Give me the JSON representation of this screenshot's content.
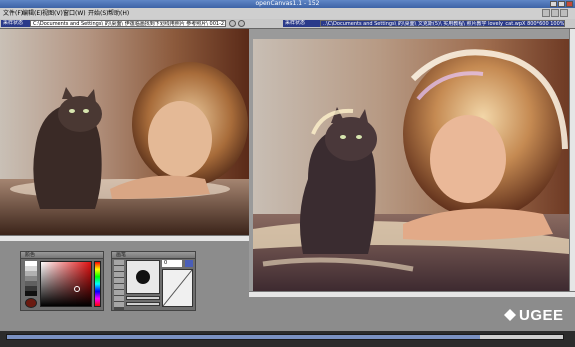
{
  "app": {
    "title": "openCanvas1.1 - 152",
    "window_buttons": [
      "minimize-button",
      "maximize-button",
      "close-button"
    ]
  },
  "menu": {
    "items": [
      "文件(F)",
      "编辑(E)",
      "视图(V)",
      "窗口(W)",
      "开始(S)",
      "帮助(H)"
    ]
  },
  "left_pane": {
    "status_label": "采样状态",
    "path": "C:\\Documents and Settings\\ 的\\桌面\\ 伊莲临画找到下划线用照片 参考照片\\ 001-213.."
  },
  "right_pane": {
    "status_label": "采样状态",
    "path": "..\\C\\Documents and Settings\\ 的\\桌面\\ 文克斯(5)\\ 实用教程\\ 照片教学 lovely_cat.wpX  800*600 100%"
  },
  "color_panel": {
    "title": "颜色",
    "selected_color": "#6b1a10",
    "swatches": [
      "#ffffff",
      "#d8d8d8",
      "#b0b0b0",
      "#888888",
      "#606060",
      "#383838",
      "#101010",
      "#6b1a10"
    ]
  },
  "brush_panel": {
    "title": "画笔",
    "size_readout": "0",
    "tools": [
      "pen-icon",
      "pencil-icon",
      "airbrush-icon",
      "marker-icon",
      "eraser-icon",
      "smudge-icon",
      "blur-icon",
      "watercolor-icon"
    ]
  },
  "brand": {
    "logo_text": "UGEE"
  }
}
